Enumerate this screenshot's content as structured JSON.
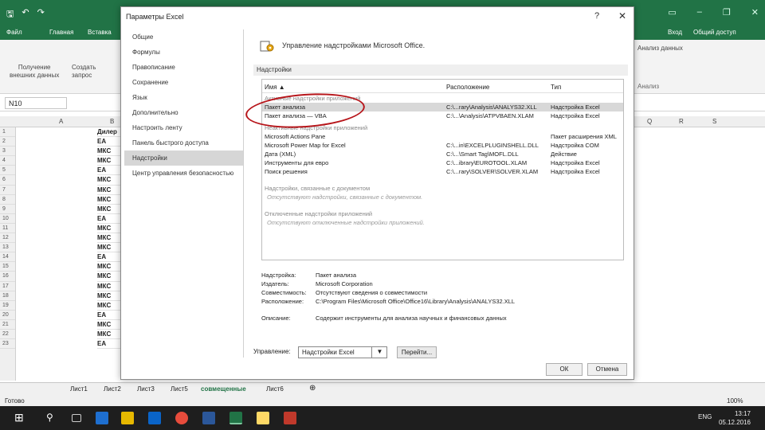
{
  "excel": {
    "tabs": [
      "Файл",
      "Главная",
      "Вставка"
    ],
    "right_tabs": [
      "Вход",
      "Общий доступ"
    ],
    "namebox": "N10",
    "ribbon_left": [
      "Получение",
      "внешних данных",
      "Создать",
      "запрос"
    ],
    "ribbon_right": "Анализ",
    "ribbon_right_top": "Анализ данных",
    "col_letters": [
      "A",
      "B",
      "Q",
      "R",
      "S"
    ],
    "rows": [
      "1",
      "2",
      "3",
      "4",
      "5",
      "6",
      "7",
      "8",
      "9",
      "10",
      "11",
      "12",
      "13",
      "14",
      "15",
      "16",
      "17",
      "18",
      "19",
      "20",
      "21",
      "22",
      "23"
    ],
    "colB": [
      "Дилер",
      "EA",
      "МКС",
      "МКС",
      "EA",
      "МКС",
      "МКС",
      "МКС",
      "МКС",
      "EA",
      "МКС",
      "МКС",
      "МКС",
      "EA",
      "МКС",
      "МКС",
      "МКС",
      "МКС",
      "МКС",
      "EA",
      "МКС",
      "МКС",
      "EA"
    ],
    "sheets": [
      "Лист1",
      "Лист2",
      "Лист3",
      "Лист5",
      "совмещенные",
      "Лист6"
    ],
    "status": "Готово",
    "zoom": "100%",
    "taskbar_lang": "ENG",
    "time": "13:17",
    "date": "05.12.2016"
  },
  "dialog": {
    "title": "Параметры Excel",
    "help": "?",
    "close": "✕",
    "nav": [
      "Общие",
      "Формулы",
      "Правописание",
      "Сохранение",
      "Язык",
      "Дополнительно",
      "Настроить ленту",
      "Панель быстрого доступа",
      "Надстройки",
      "Центр управления безопасностью"
    ],
    "active_nav": 8,
    "header": "Управление надстройками Microsoft Office.",
    "section": "Надстройки",
    "cols": {
      "name": "Имя ▲",
      "location": "Расположение",
      "type": "Тип"
    },
    "groups": {
      "active": "Активные надстройки приложений",
      "inactive": "Неактивные надстройки приложений",
      "document": "Надстройки, связанные с документом",
      "disabled": "Отключенные надстройки приложений"
    },
    "active_items": [
      {
        "name": "Пакет анализа",
        "location": "C:\\...rary\\Analysis\\ANALYS32.XLL",
        "type": "Надстройка Excel"
      },
      {
        "name": "Пакет анализа — VBA",
        "location": "C:\\...\\Analysis\\ATPVBAEN.XLAM",
        "type": "Надстройка Excel"
      }
    ],
    "inactive_items": [
      {
        "name": "Microsoft Actions Pane",
        "location": "",
        "type": "Пакет расширения XML"
      },
      {
        "name": "Microsoft Power Map for Excel",
        "location": "C:\\...in\\EXCELPLUGINSHELL.DLL",
        "type": "Надстройка COM"
      },
      {
        "name": "Дата (XML)",
        "location": "C:\\...\\Smart Tag\\MOFL.DLL",
        "type": "Действие"
      },
      {
        "name": "Инструменты для евро",
        "location": "C:\\...ibrary\\EUROTOOL.XLAM",
        "type": "Надстройка Excel"
      },
      {
        "name": "Поиск решения",
        "location": "C:\\...rary\\SOLVER\\SOLVER.XLAM",
        "type": "Надстройка Excel"
      }
    ],
    "doc_empty": "Отсутствуют надстройки, связанные с документом.",
    "disabled_empty": "Отсутствуют отключенные надстройки приложений.",
    "details": [
      {
        "label": "Надстройка:",
        "value": "Пакет анализа"
      },
      {
        "label": "Издатель:",
        "value": "Microsoft Corporation"
      },
      {
        "label": "Совместимость:",
        "value": "Отсутствуют сведения о совместимости"
      },
      {
        "label": "Расположение:",
        "value": "C:\\Program Files\\Microsoft Office\\Office16\\Library\\Analysis\\ANALYS32.XLL"
      },
      {
        "label": "Описание:",
        "value": "Содержит инструменты для анализа научных и финансовых данных"
      }
    ],
    "manage_label": "Управление:",
    "manage_value": "Надстройки Excel",
    "go": "Перейти...",
    "ok": "ОК",
    "cancel": "Отмена"
  },
  "colors": {
    "excel_green": "#217346",
    "highlight": "#b7151a"
  }
}
